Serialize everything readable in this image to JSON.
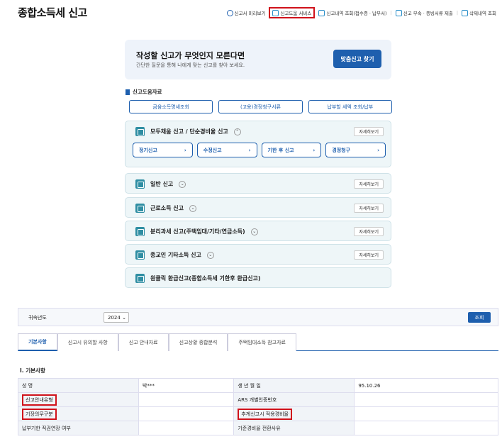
{
  "page": {
    "title": "종합소득세 신고"
  },
  "topnav": [
    {
      "label": "신고서 미리보기",
      "icon": "search-icon",
      "highlight": false
    },
    {
      "label": "신고도움 서비스",
      "icon": "help-icon",
      "highlight": true
    },
    {
      "label": "신고내역 조회(접수증 · 납부서)",
      "icon": "document-icon",
      "highlight": false
    },
    {
      "label": "신고 부속 · 증빙서류 제출",
      "icon": "upload-icon",
      "highlight": false
    },
    {
      "label": "삭제내역 조회",
      "icon": "trash-icon",
      "highlight": false
    }
  ],
  "banner": {
    "title": "작성할 신고가 무엇인지 모른다면",
    "subtitle": "간단한 질문을 통해 나에게 맞는 신고를 찾아 보세요.",
    "button": "맞춤신고 찾기"
  },
  "help": {
    "title": "신고도움자료",
    "links": [
      "금융소득명세조회",
      "(고용)경정청구서류",
      "납부할 세액 조회/납부"
    ]
  },
  "accordions": [
    {
      "label": "모두채움 신고 / 단순경비율 신고",
      "detail": "자세히보기",
      "expanded": true,
      "sub": [
        "정기신고",
        "수정신고",
        "기한 후 신고",
        "경정청구"
      ]
    },
    {
      "label": "일반 신고",
      "detail": "자세히보기",
      "expanded": false
    },
    {
      "label": "근로소득 신고",
      "detail": "자세히보기",
      "expanded": false
    },
    {
      "label": "분리과세 신고(주택임대/기타/연금소득)",
      "detail": "자세히보기",
      "expanded": false
    },
    {
      "label": "종교인 기타소득 신고",
      "detail": "자세히보기",
      "expanded": false
    },
    {
      "label": "원클릭 환급신고(종합소득세 기한후 환급신고)",
      "detail": "",
      "expanded": false
    }
  ],
  "year": {
    "label": "귀속년도",
    "value": "2024",
    "button": "조회"
  },
  "tabs": [
    "기본사항",
    "신고시 유의할 사항",
    "신고 안내자료",
    "신고상황 종합분석",
    "주택임대소득 참고자료"
  ],
  "basic": {
    "title": "Ⅰ. 기본사항",
    "rows": [
      [
        "성        명",
        "박***",
        "생 년 월 일",
        "95.10.26"
      ],
      [
        "신고안내유형",
        "",
        "ARS 개별인증번호",
        ""
      ],
      [
        "기장의무구분",
        "",
        "추계신고시 적용경비율",
        ""
      ],
      [
        "납부기한 직권연장 여부",
        "",
        "기준경비율 전환사유",
        ""
      ]
    ]
  }
}
